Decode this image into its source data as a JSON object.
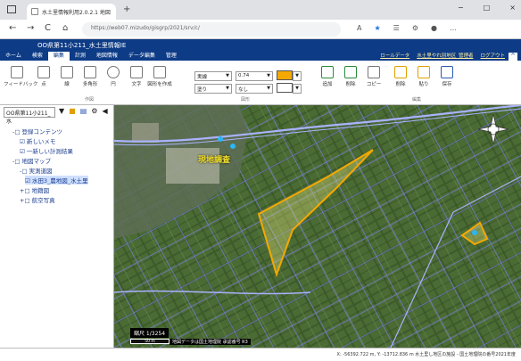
{
  "browser": {
    "tab_title": "水土里情報利用2.0.2.1 地図 x",
    "tab_close": "×",
    "new_tab": "+",
    "window_controls": [
      "−",
      "□",
      "×"
    ],
    "url": "https://web07.mizudo/gisgrp/2021/srv/c/",
    "nav": [
      "←",
      "→",
      "C",
      "⌂"
    ]
  },
  "app": {
    "title": "OO県第11小211_水土里情報IE",
    "menu": [
      "ホーム",
      "検索",
      "編集",
      "計測",
      "地図情報",
      "データ編集",
      "管理"
    ],
    "active_menu": "編集",
    "top_links": [
      "ロールデータ",
      "水土里やれ別地区_管理者",
      "ログアウト"
    ],
    "collapse": "^"
  },
  "ribbon": {
    "buttons": [
      "フィードバック",
      "点",
      "線",
      "多角形",
      "円",
      "文字",
      "図形を作成",
      "追加",
      "削除",
      "コピー",
      "削除",
      "貼り",
      "保存"
    ],
    "selects": [
      "実線",
      "0.74",
      "塗り",
      "なし"
    ],
    "groups": [
      "作図",
      "図形",
      "編集"
    ]
  },
  "left_panel": {
    "layer_select": "OO県第11小211_水",
    "tree": [
      "-□ 登録コンテンツ",
      "☑ 新しいメモ",
      "☑ 一新しい計測結果",
      "-□ 地図マップ",
      "-□ 実測道図",
      "☑ 水田3_農地図_水土里",
      "+□ 地籍図",
      "+□ 航空写真"
    ]
  },
  "map": {
    "poi_label": "現地調査",
    "scale": "縮尺 1/3254",
    "scale_bar": "50 m",
    "attribution": "地図データは国土地理院 承認番号 R3"
  },
  "status": {
    "coords": "X: -56392.722 m, Y: -13712.836 m  水土里し地区の施設 - 国土地理院の番号2021年度"
  }
}
